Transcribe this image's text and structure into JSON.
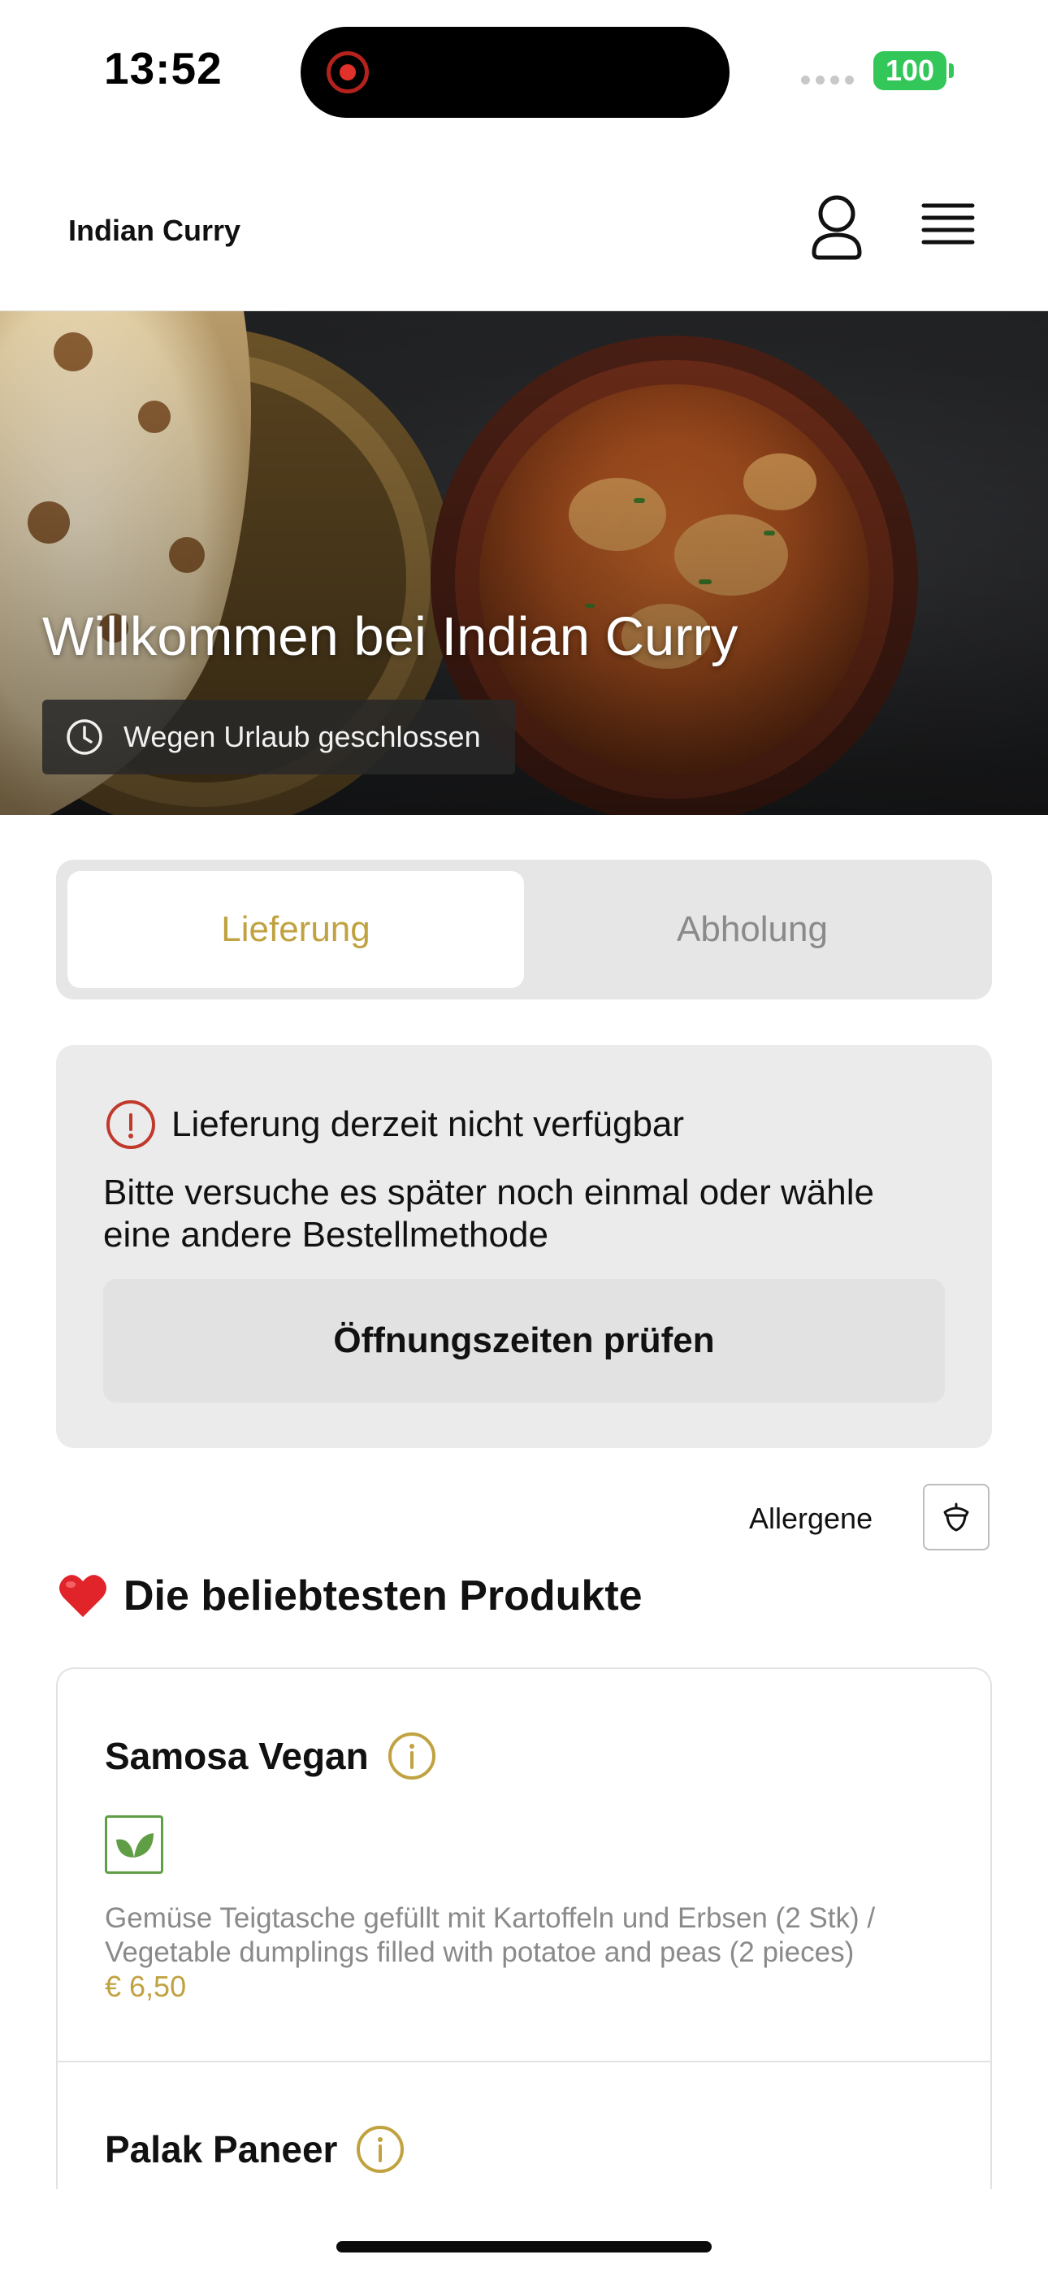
{
  "status_bar": {
    "time": "13:52",
    "battery": "100"
  },
  "header": {
    "brand": "Indian Curry"
  },
  "hero": {
    "title": "Willkommen bei Indian Curry",
    "status": "Wegen Urlaub geschlossen"
  },
  "tabs": [
    {
      "label": "Lieferung",
      "active": true
    },
    {
      "label": "Abholung",
      "active": false
    }
  ],
  "alert": {
    "title": "Lieferung derzeit nicht verfügbar",
    "message": "Bitte versuche es später noch einmal oder wähle eine andere Bestellmethode",
    "button": "Öffnungszeiten prüfen"
  },
  "allergens": {
    "label": "Allergene"
  },
  "section": {
    "emoji": "❤️",
    "title": "Die beliebtesten Produkte"
  },
  "products": [
    {
      "name": "Samosa Vegan",
      "description": "Gemüse Teigtasche gefüllt mit Kartoffeln und Erbsen (2 Stk) / Vegetable dumplings filled with potatoe and peas (2 pieces)",
      "price": "€ 6,50"
    },
    {
      "name": "Palak Paneer"
    }
  ],
  "colors": {
    "accent": "#c0a240",
    "alert_icon": "#c0392b",
    "veg_green": "#5f9e44",
    "battery": "#33c759"
  }
}
